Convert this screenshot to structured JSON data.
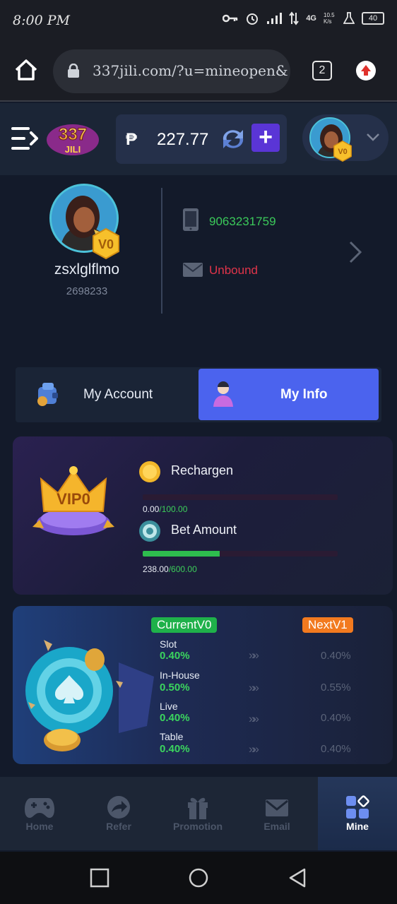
{
  "status_bar": {
    "time": "8:00 PM",
    "network": "4G",
    "speed": "10.5 K/s",
    "battery": "40"
  },
  "browser": {
    "url": "337jili.com/?u=mineopen&",
    "tab_count": "2"
  },
  "header": {
    "logo_text": "337 JILI",
    "currency": "₱",
    "balance": "227.77",
    "add_label": "+",
    "vip_level": "V0"
  },
  "profile": {
    "username": "zsxlglflmo",
    "user_id": "2698233",
    "vip_badge": "V0",
    "phone": "9063231759",
    "email_status": "Unbound"
  },
  "tabs": [
    {
      "label": "My Account",
      "active": false
    },
    {
      "label": "My Info",
      "active": true
    }
  ],
  "vip_progress": {
    "crown_label": "VIP0",
    "recharge": {
      "label": "Rechargen",
      "current": "0.00",
      "target": "/100.00",
      "fraction": 0.0
    },
    "bet": {
      "label": "Bet Amount",
      "current": "238.00",
      "target": "/600.00",
      "fraction": 0.3967
    }
  },
  "rebate": {
    "current_label": "CurrentV0",
    "next_label": "NextV1",
    "rows": [
      {
        "name": "Slot",
        "current": "0.40%",
        "arrow": "»»",
        "next": "0.40%"
      },
      {
        "name": "In-House",
        "current": "0.50%",
        "arrow": "»»",
        "next": "0.55%"
      },
      {
        "name": "Live",
        "current": "0.40%",
        "arrow": "»»",
        "next": "0.40%"
      },
      {
        "name": "Table",
        "current": "0.40%",
        "arrow": "»»",
        "next": "0.40%"
      }
    ]
  },
  "bottom_nav": [
    {
      "label": "Home",
      "icon": "gamepad-icon"
    },
    {
      "label": "Refer",
      "icon": "share-icon"
    },
    {
      "label": "Promotion",
      "icon": "gift-icon"
    },
    {
      "label": "Email",
      "icon": "envelope-icon"
    },
    {
      "label": "Mine",
      "icon": "grid-icon",
      "active": true
    }
  ],
  "colors": {
    "accent_blue": "#4b63ee",
    "accent_purple": "#5a35d6",
    "green": "#3bc95a",
    "red": "#e0344a",
    "orange": "#f27a1f"
  }
}
